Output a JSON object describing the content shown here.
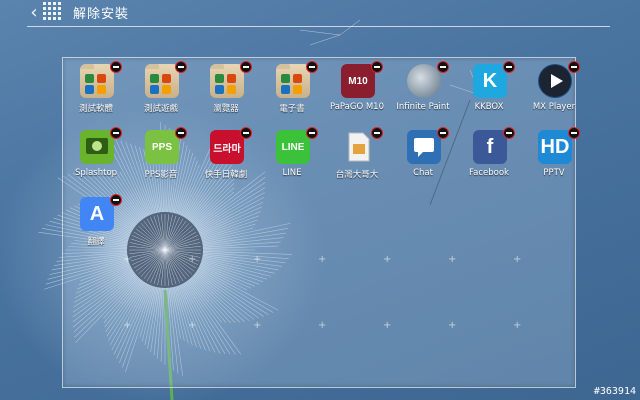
{
  "header": {
    "title": "解除安裝"
  },
  "apps": [
    {
      "label": "測試軟體",
      "icon": "folder-icon",
      "color": "#c9b08a"
    },
    {
      "label": "測試遊戲",
      "icon": "folder-icon",
      "color": "#c9b08a"
    },
    {
      "label": "瀏覽器",
      "icon": "folder-icon",
      "color": "#c9b08a"
    },
    {
      "label": "電子書",
      "icon": "folder-icon",
      "color": "#c9b08a"
    },
    {
      "label": "PaPaGO M10",
      "icon": "papago-icon",
      "color": "#8b1e2e",
      "tile_text": "M10"
    },
    {
      "label": "Infinite Paint",
      "icon": "infinite-paint-icon",
      "color": "#5a6f80"
    },
    {
      "label": "KKBOX",
      "icon": "kkbox-icon",
      "color": "#1fa8e0",
      "tile_text": "K"
    },
    {
      "label": "MX Player",
      "icon": "mx-player-icon",
      "color": "#1b4e86"
    },
    {
      "label": "Splashtop",
      "icon": "splashtop-icon",
      "color": "#6ab42d"
    },
    {
      "label": "PPS影音",
      "icon": "pps-icon",
      "color": "#7cc242",
      "tile_text": "PPS"
    },
    {
      "label": "快手日韓劇",
      "icon": "drama-icon",
      "color": "#c8102e",
      "tile_text": "드라마"
    },
    {
      "label": "LINE",
      "icon": "line-icon",
      "color": "#3cc13b",
      "tile_text": "LINE"
    },
    {
      "label": "台灣大哥大",
      "icon": "sim-card-icon",
      "color": "#e38b2a"
    },
    {
      "label": "Chat",
      "icon": "chat-icon",
      "color": "#2f6fb3"
    },
    {
      "label": "Facebook",
      "icon": "facebook-icon",
      "color": "#3b5998",
      "tile_text": "f"
    },
    {
      "label": "PPTV",
      "icon": "pptv-icon",
      "color": "#1e8ad6",
      "tile_text": "HD"
    },
    {
      "label": "翻譯",
      "icon": "translate-icon",
      "color": "#4285f4",
      "tile_text": "A"
    }
  ],
  "watermark": "#363914"
}
